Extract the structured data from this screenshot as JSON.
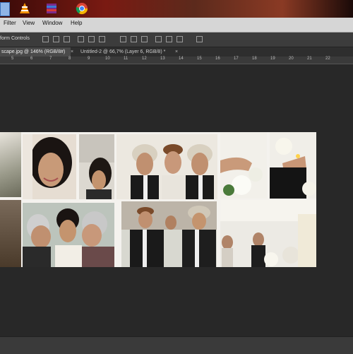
{
  "menu": {
    "items": [
      {
        "label": "Filter"
      },
      {
        "label": "View"
      },
      {
        "label": "Window"
      },
      {
        "label": "Help"
      }
    ]
  },
  "options_bar": {
    "label": "form Controls"
  },
  "tabs": [
    {
      "label": "scape.jpg @ 146% (RGB/8#)",
      "active": true
    },
    {
      "label": "Untitled-2 @ 66,7% (Layer 6, RGB/8) *",
      "active": false
    }
  ],
  "ruler": {
    "ticks": [
      "5",
      "6",
      "7",
      "8",
      "9",
      "10",
      "11",
      "12",
      "13",
      "14",
      "15",
      "16",
      "17",
      "18",
      "19",
      "20",
      "21",
      "22"
    ]
  },
  "colors": {
    "workspace": "#282828",
    "menubar": "#d6d6d6",
    "options_bar": "#3c3c3c",
    "active_tab": "#4a4a4a"
  },
  "icons": [
    "windows-start-icon",
    "vlc-icon",
    "winrar-icon",
    "chrome-icon"
  ]
}
